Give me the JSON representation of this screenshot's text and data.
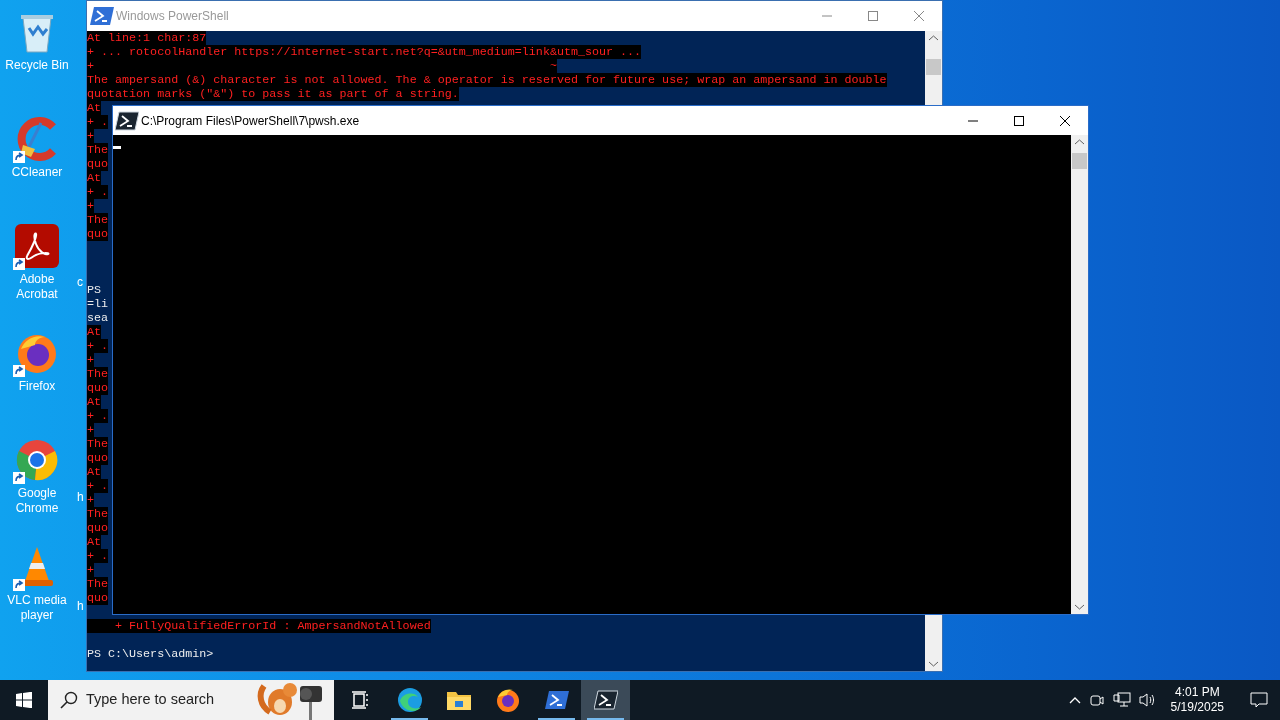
{
  "desktop_icons": [
    {
      "label": "Recycle Bin",
      "kind": "recycle",
      "shortcut": false
    },
    {
      "label": "CCleaner",
      "kind": "ccleaner",
      "shortcut": true
    },
    {
      "label": "Adobe Acrobat",
      "kind": "acrobat",
      "shortcut": true
    },
    {
      "label": "Firefox",
      "kind": "firefox",
      "shortcut": true
    },
    {
      "label": "Google Chrome",
      "kind": "chrome",
      "shortcut": true
    },
    {
      "label": "VLC media player",
      "kind": "vlc",
      "shortcut": true
    }
  ],
  "desktop_fragments": [
    "c",
    "h",
    "h"
  ],
  "back_window": {
    "title": "Windows PowerShell",
    "lines": [
      {
        "kind": "error",
        "text": "At line:1 char:87"
      },
      {
        "kind": "error",
        "text": "+ ... rotocolHandler https://internet-start.net?q=&utm_medium=link&utm_sour ..."
      },
      {
        "kind": "error",
        "text": "+                                                                 ~"
      },
      {
        "kind": "error",
        "text": "The ampersand (&) character is not allowed. The & operator is reserved for future use; wrap an ampersand in double"
      },
      {
        "kind": "error",
        "text": "quotation marks (\"&\") to pass it as part of a string."
      },
      {
        "kind": "error",
        "text": "At"
      },
      {
        "kind": "error",
        "text": "+ ."
      },
      {
        "kind": "error",
        "text": "+"
      },
      {
        "kind": "error",
        "text": "The"
      },
      {
        "kind": "error",
        "text": "quo"
      },
      {
        "kind": "error",
        "text": "At"
      },
      {
        "kind": "error",
        "text": "+ ."
      },
      {
        "kind": "error",
        "text": "+"
      },
      {
        "kind": "error",
        "text": "The"
      },
      {
        "kind": "error",
        "text": "quo"
      },
      {
        "kind": "blank"
      },
      {
        "kind": "blank"
      },
      {
        "kind": "blank"
      },
      {
        "kind": "prompt",
        "text": "PS"
      },
      {
        "kind": "prompt",
        "text": "=li"
      },
      {
        "kind": "prompt",
        "text": "sea"
      },
      {
        "kind": "error",
        "text": "At"
      },
      {
        "kind": "error",
        "text": "+ ."
      },
      {
        "kind": "error",
        "text": "+"
      },
      {
        "kind": "error",
        "text": "The"
      },
      {
        "kind": "error",
        "text": "quo"
      },
      {
        "kind": "error",
        "text": "At"
      },
      {
        "kind": "error",
        "text": "+ ."
      },
      {
        "kind": "error",
        "text": "+"
      },
      {
        "kind": "error",
        "text": "The"
      },
      {
        "kind": "error",
        "text": "quo"
      },
      {
        "kind": "error",
        "text": "At"
      },
      {
        "kind": "error",
        "text": "+ ."
      },
      {
        "kind": "error",
        "text": "+"
      },
      {
        "kind": "error",
        "text": "The"
      },
      {
        "kind": "error",
        "text": "quo"
      },
      {
        "kind": "error",
        "text": "At"
      },
      {
        "kind": "error",
        "text": "+ ."
      },
      {
        "kind": "error",
        "text": "+"
      },
      {
        "kind": "error",
        "text": "The"
      },
      {
        "kind": "error",
        "text": "quo"
      },
      {
        "kind": "blank"
      },
      {
        "kind": "error",
        "text": "    + FullyQualifiedErrorId : AmpersandNotAllowed"
      },
      {
        "kind": "blank"
      },
      {
        "kind": "prompt",
        "text": "PS C:\\Users\\admin>"
      }
    ]
  },
  "front_window": {
    "title": "C:\\Program Files\\PowerShell\\7\\pwsh.exe"
  },
  "taskbar": {
    "search_placeholder": "Type here to search",
    "apps": [
      {
        "kind": "taskview",
        "running": false,
        "selected": false
      },
      {
        "kind": "edge",
        "running": true,
        "selected": false
      },
      {
        "kind": "explorer",
        "running": false,
        "selected": false
      },
      {
        "kind": "firefox",
        "running": false,
        "selected": false
      },
      {
        "kind": "powershell",
        "running": true,
        "selected": false
      },
      {
        "kind": "pwsh",
        "running": true,
        "selected": true
      }
    ],
    "time": "4:01 PM",
    "date": "5/19/2025"
  }
}
